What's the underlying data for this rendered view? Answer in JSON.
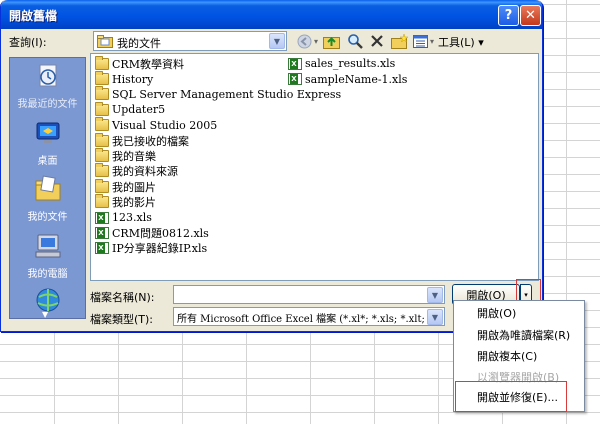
{
  "dialog": {
    "title": "開啟舊檔",
    "help_label": "?",
    "close_label": "✕"
  },
  "toolbar": {
    "lookin_label": "查詢(I):",
    "lookin_value": "我的文件",
    "tools_label": "工具(L) ▾",
    "icons": [
      "back-icon",
      "up-folder-icon",
      "search-web-icon",
      "delete-icon",
      "new-folder-icon",
      "views-icon"
    ]
  },
  "places": [
    {
      "label": "我最近的文件",
      "icon": "recent-docs-icon"
    },
    {
      "label": "桌面",
      "icon": "desktop-icon"
    },
    {
      "label": "我的文件",
      "icon": "my-documents-icon"
    },
    {
      "label": "我的電腦",
      "icon": "my-computer-icon"
    },
    {
      "label": "",
      "icon": "network-places-icon"
    }
  ],
  "files": {
    "left_column": [
      {
        "name": "CRM教學資料",
        "type": "folder"
      },
      {
        "name": "History",
        "type": "folder"
      },
      {
        "name": "SQL Server Management Studio Express",
        "type": "folder"
      },
      {
        "name": "Updater5",
        "type": "folder"
      },
      {
        "name": "Visual Studio 2005",
        "type": "folder"
      },
      {
        "name": "我已接收的檔案",
        "type": "folder"
      },
      {
        "name": "我的音樂",
        "type": "folder"
      },
      {
        "name": "我的資料來源",
        "type": "folder"
      },
      {
        "name": "我的圖片",
        "type": "folder"
      },
      {
        "name": "我的影片",
        "type": "folder"
      },
      {
        "name": "123.xls",
        "type": "xls"
      },
      {
        "name": "CRM問題0812.xls",
        "type": "xls"
      },
      {
        "name": "IP分享器紀錄IP.xls",
        "type": "xls"
      }
    ],
    "right_column": [
      {
        "name": "sales_results.xls",
        "type": "xls"
      },
      {
        "name": "sampleName-1.xls",
        "type": "xls"
      }
    ]
  },
  "bottom": {
    "filename_label": "檔案名稱(N):",
    "filename_value": "",
    "filetype_label": "檔案類型(T):",
    "filetype_value": "所有 Microsoft Office Excel 檔案 (*.xl*; *.xls; *.xlt; *.htm",
    "open_label": "開啟(O)",
    "split_arrow": "▾"
  },
  "menu": {
    "items": [
      {
        "label": "開啟(O)",
        "disabled": false
      },
      {
        "label": "開啟為唯讀檔案(R)",
        "disabled": false
      },
      {
        "label": "開啟複本(C)",
        "disabled": false
      },
      {
        "label": "以瀏覽器開啟(B)",
        "disabled": true
      },
      {
        "label": "開啟並修復(E)...",
        "disabled": false
      }
    ]
  },
  "colors": {
    "titlebar": "#0054e3",
    "dialog_bg": "#ece9d8",
    "places_bg": "#7c98d3",
    "highlight_box": "#d93a3a"
  }
}
